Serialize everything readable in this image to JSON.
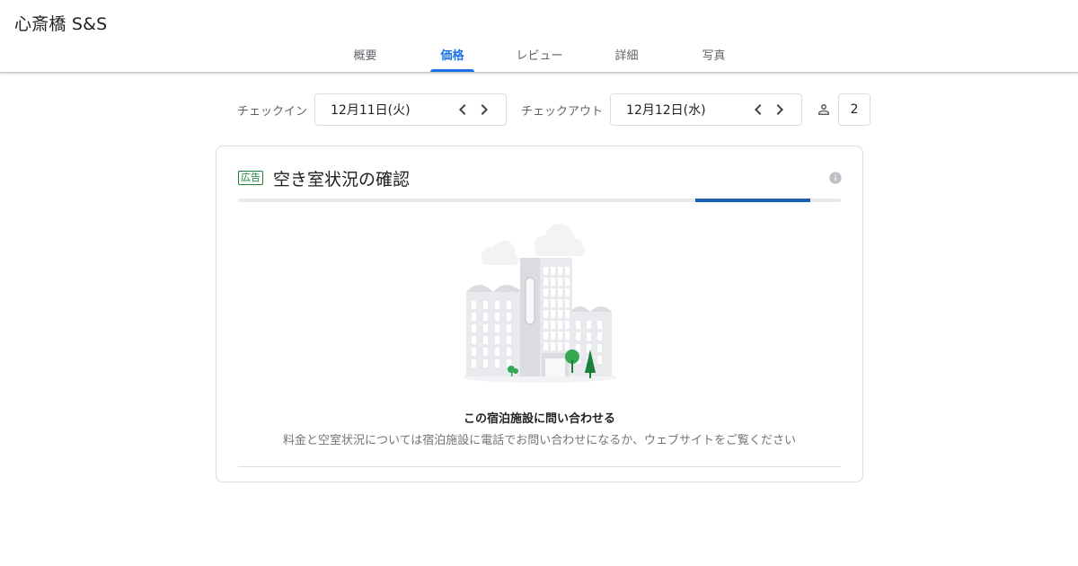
{
  "header": {
    "hotel_name": "心斎橋 S&S",
    "tabs": [
      {
        "label": "概要",
        "active": false
      },
      {
        "label": "価格",
        "active": true
      },
      {
        "label": "レビュー",
        "active": false
      },
      {
        "label": "詳細",
        "active": false
      },
      {
        "label": "写真",
        "active": false
      }
    ]
  },
  "dates": {
    "checkin_label": "チェックイン",
    "checkin_value": "12月11日(火)",
    "checkout_label": "チェックアウト",
    "checkout_value": "12月12日(水)",
    "guests": "2",
    "icons": {
      "prev": "chevron-left-icon",
      "next": "chevron-right-icon",
      "guest": "person-icon"
    }
  },
  "availability": {
    "ad_badge": "広告",
    "title": "空き室状況の確認",
    "info_icon": "info-icon",
    "progress": {
      "start": 0.758,
      "end": 0.95
    },
    "contact_title": "この宿泊施設に問い合わせる",
    "contact_desc": "料金と空室状況については宿泊施設に電話でお問い合わせになるか、ウェブサイトをご覧ください"
  },
  "colors": {
    "accent": "#1a73e8",
    "progress": "#1a5fb4",
    "ad_green": "#188038",
    "tree_green": "#34a853",
    "border": "#dadce0"
  }
}
